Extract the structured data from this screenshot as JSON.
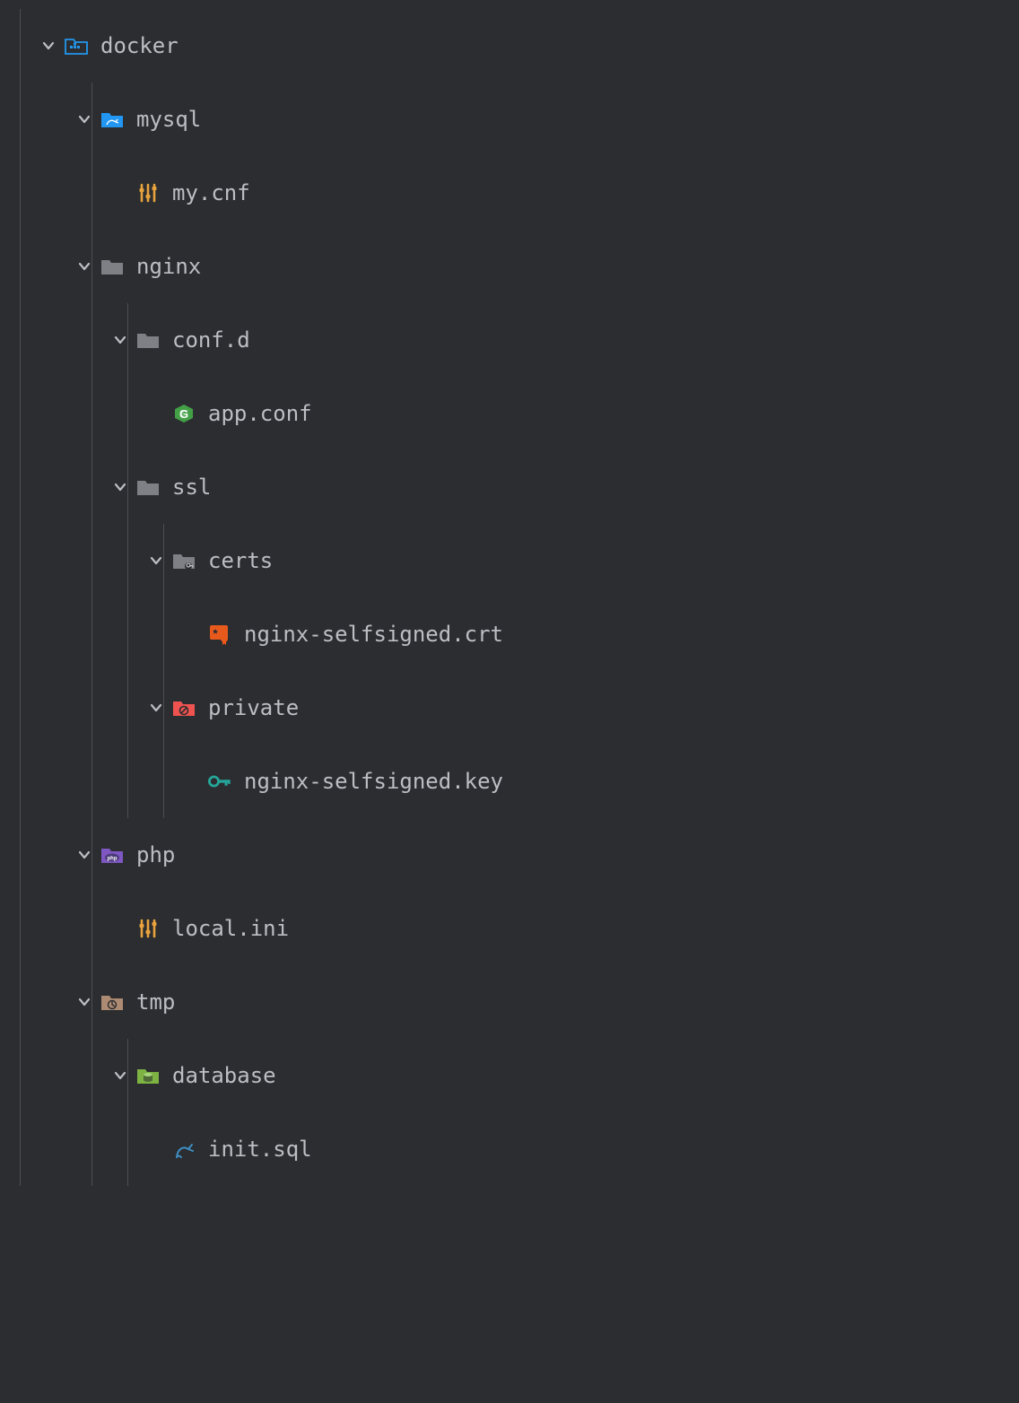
{
  "tree": {
    "docker": "docker",
    "mysql": "mysql",
    "my_cnf": "my.cnf",
    "nginx": "nginx",
    "conf_d": "conf.d",
    "app_conf": "app.conf",
    "ssl": "ssl",
    "certs": "certs",
    "crt": "nginx-selfsigned.crt",
    "private": "private",
    "key": "nginx-selfsigned.key",
    "php": "php",
    "local_ini": "local.ini",
    "tmp": "tmp",
    "database": "database",
    "init_sql": "init.sql"
  },
  "colors": {
    "chevron": "#bcbec4",
    "folder_gray": "#7e8085",
    "docker_blue": "#2496ed",
    "mysql_blue": "#2196f3",
    "config_orange": "#e8a33d",
    "nginx_green": "#43a047",
    "cert_orange": "#e8591c",
    "private_red": "#ef5350",
    "key_teal": "#26a69a",
    "php_purple": "#7e57c2",
    "tmp_brown": "#ad8b73",
    "db_green": "#7cb342",
    "sql_blue": "#3f8ec2",
    "guide": "#4a4d52"
  }
}
